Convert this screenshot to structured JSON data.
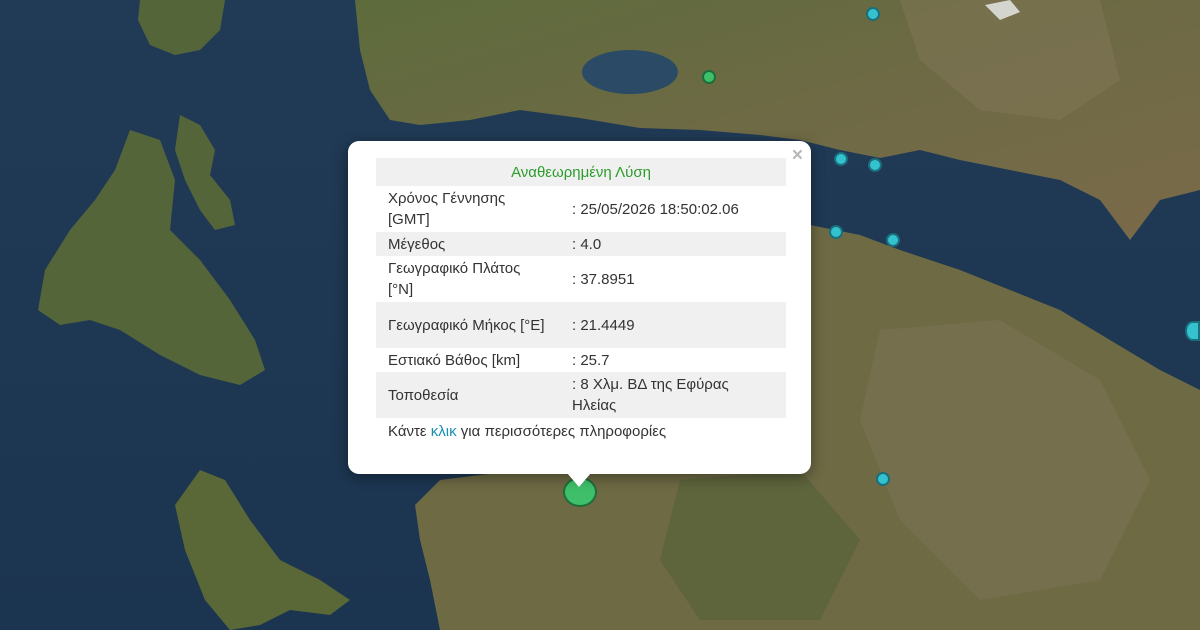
{
  "popup": {
    "title": "Αναθεωρημένη Λύση",
    "close_label": "×",
    "rows": [
      {
        "label": "Χρόνος Γέννησης [GMT]",
        "value": ": 25/05/2026 18:50:02.06"
      },
      {
        "label": "Μέγεθος",
        "value": ": 4.0"
      },
      {
        "label": "Γεωγραφικό Πλάτος [°N]",
        "value": ": 37.8951"
      },
      {
        "label": "Γεωγραφικό Μήκος [°E]",
        "value": ": 21.4449"
      },
      {
        "label": "Εστιακό Βάθος [km]",
        "value": ": 25.7"
      },
      {
        "label": "Τοποθεσία",
        "value": ": 8 Χλμ. ΒΔ της Εφύρας Ηλείας"
      }
    ],
    "more_prefix": "Κάντε ",
    "more_link": "κλικ",
    "more_suffix": " για περισσότερες πληροφορίες"
  },
  "colors": {
    "sea": "#1f3a55",
    "land": "#5a6a3a",
    "title_green": "#2a9d2a",
    "link_blue": "#1a8fb5",
    "marker_cyan": "#34c2cf",
    "marker_green": "#3fbf6a"
  },
  "map": {
    "type": "satellite",
    "markers": [
      {
        "kind": "selected-event",
        "color": "green"
      },
      {
        "kind": "event",
        "color": "green"
      },
      {
        "kind": "event",
        "color": "cyan"
      },
      {
        "kind": "event",
        "color": "cyan"
      },
      {
        "kind": "event",
        "color": "cyan"
      },
      {
        "kind": "event",
        "color": "cyan"
      },
      {
        "kind": "event",
        "color": "cyan"
      },
      {
        "kind": "event",
        "color": "cyan"
      },
      {
        "kind": "event",
        "color": "cyan"
      }
    ]
  }
}
